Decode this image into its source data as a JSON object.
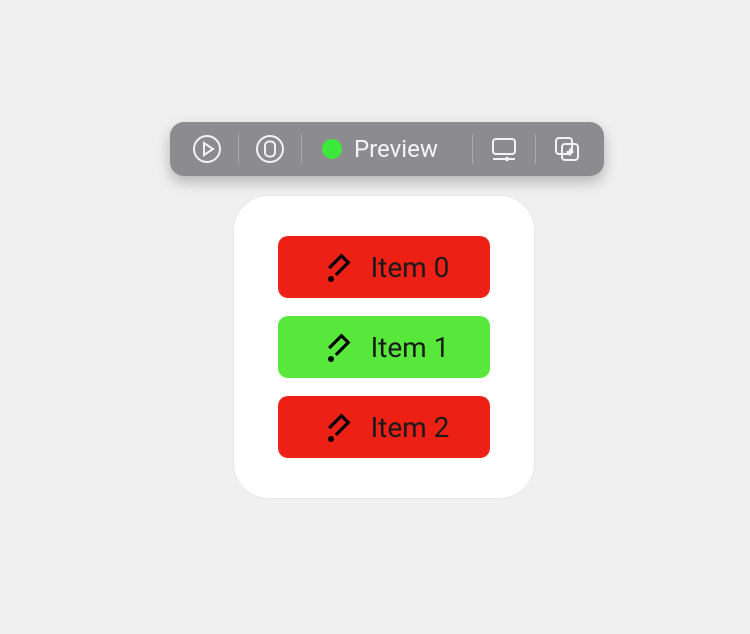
{
  "toolbar": {
    "preview_label": "Preview",
    "status_color": "#3ce83c"
  },
  "list": {
    "items": [
      {
        "label": "Item 0",
        "selected": false
      },
      {
        "label": "Item 1",
        "selected": true
      },
      {
        "label": "Item 2",
        "selected": false
      }
    ],
    "colors": {
      "selected": "#58e83c",
      "default": "#ed2015"
    },
    "icon": "ticket-icon"
  }
}
